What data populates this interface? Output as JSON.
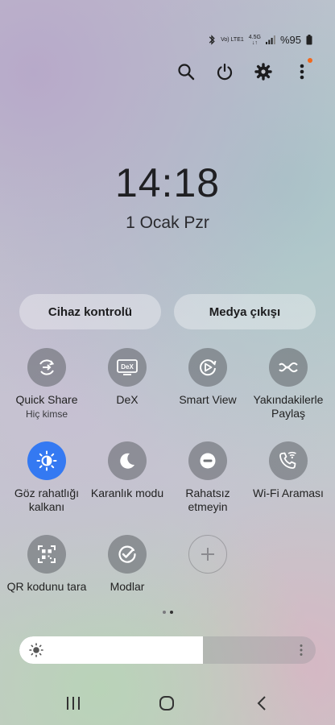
{
  "status": {
    "network_top": "Vo) LTE1",
    "network_gen": "4.5G",
    "battery": "%95"
  },
  "actions": [
    "search-icon",
    "power-icon",
    "settings-icon",
    "more-icon"
  ],
  "clock": {
    "time": "14:18",
    "date": "1 Ocak Pzr"
  },
  "pills": {
    "device_control": "Cihaz kontrolü",
    "media_output": "Medya çıkışı"
  },
  "tiles": [
    {
      "label": "Quick Share",
      "sub": "Hiç kimse",
      "icon": "quick-share-icon"
    },
    {
      "label": "DeX",
      "icon": "dex-icon",
      "icon_text": "DeX"
    },
    {
      "label": "Smart View",
      "icon": "smart-view-icon"
    },
    {
      "label": "Yakındakilerle Paylaş",
      "icon": "nearby-share-icon"
    },
    {
      "label": "Göz rahatlığı kalkanı",
      "icon": "eye-comfort-icon",
      "active": true
    },
    {
      "label": "Karanlık modu",
      "icon": "dark-mode-icon"
    },
    {
      "label": "Rahatsız etmeyin",
      "icon": "do-not-disturb-icon"
    },
    {
      "label": "Wi-Fi Araması",
      "icon": "wifi-calling-icon"
    },
    {
      "label": "QR kodunu tara",
      "icon": "qr-scan-icon"
    },
    {
      "label": "Modlar",
      "icon": "modes-icon"
    },
    {
      "label": "",
      "icon": "add-icon"
    }
  ],
  "page_indicator": {
    "pages": 2,
    "current": 2
  },
  "brightness": {
    "level_percent": 62
  },
  "nav": [
    "recents-icon",
    "home-icon",
    "back-icon"
  ],
  "colors": {
    "active_tile": "#3479f2",
    "badge": "#f2681c"
  }
}
